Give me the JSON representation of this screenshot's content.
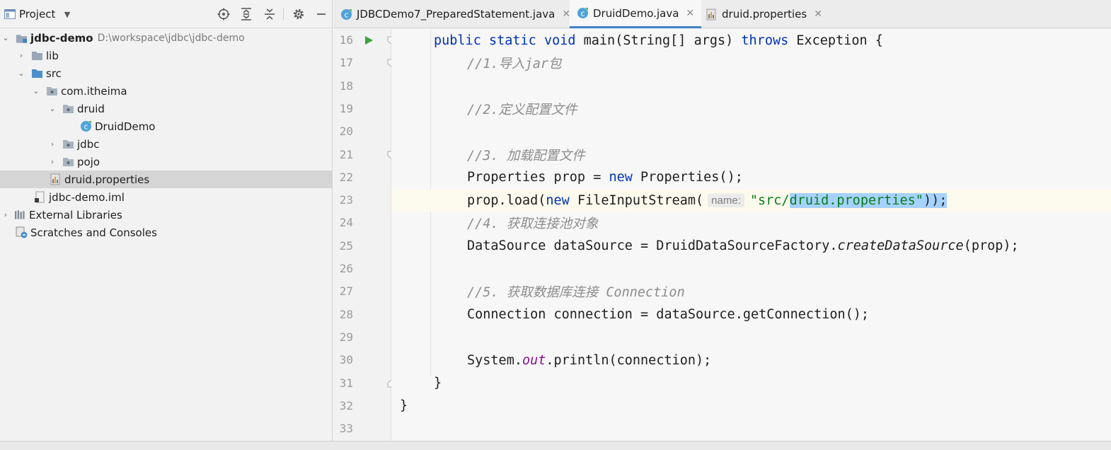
{
  "project_panel": {
    "title": "Project",
    "tree": [
      {
        "label": "jdbc-demo",
        "path": "D:\\workspace\\jdbc\\jdbc-demo",
        "icon": "module-folder-icon",
        "expanded": true
      },
      {
        "label": "lib",
        "icon": "folder-icon",
        "expanded": false
      },
      {
        "label": "src",
        "icon": "source-folder-icon",
        "expanded": true
      },
      {
        "label": "com.itheima",
        "icon": "package-icon",
        "expanded": true
      },
      {
        "label": "druid",
        "icon": "package-icon",
        "expanded": true
      },
      {
        "label": "DruidDemo",
        "icon": "java-class-icon"
      },
      {
        "label": "jdbc",
        "icon": "package-icon",
        "expanded": false
      },
      {
        "label": "pojo",
        "icon": "package-icon",
        "expanded": false
      },
      {
        "label": "druid.properties",
        "icon": "properties-file-icon",
        "selected": true
      },
      {
        "label": "jdbc-demo.iml",
        "icon": "iml-file-icon"
      },
      {
        "label": "External Libraries",
        "icon": "libraries-icon",
        "expanded": false
      },
      {
        "label": "Scratches and Consoles",
        "icon": "scratches-icon"
      }
    ]
  },
  "tabs": [
    {
      "label": "JDBCDemo7_PreparedStatement.java",
      "icon": "java-class-icon",
      "active": false
    },
    {
      "label": "DruidDemo.java",
      "icon": "java-class-icon",
      "active": true
    },
    {
      "label": "druid.properties",
      "icon": "properties-file-icon",
      "active": false
    }
  ],
  "editor": {
    "current_line": 23,
    "lines": [
      {
        "no": "16",
        "tokens": [
          [
            "kw",
            "public "
          ],
          [
            "kw",
            "static "
          ],
          [
            "kw",
            "void "
          ],
          [
            "",
            "main(String[] args) "
          ],
          [
            "kw",
            "throws "
          ],
          [
            "",
            "Exception {"
          ]
        ]
      },
      {
        "no": "17",
        "tokens": [
          [
            "cm",
            "//1.导入jar包"
          ]
        ]
      },
      {
        "no": "18",
        "tokens": []
      },
      {
        "no": "19",
        "tokens": [
          [
            "cm",
            "//2.定义配置文件"
          ]
        ]
      },
      {
        "no": "20",
        "tokens": []
      },
      {
        "no": "21",
        "tokens": [
          [
            "cm",
            "//3. 加载配置文件"
          ]
        ]
      },
      {
        "no": "22",
        "tokens": [
          [
            "",
            "Properties prop = "
          ],
          [
            "kw",
            "new "
          ],
          [
            "",
            "Properties();"
          ]
        ]
      },
      {
        "no": "23",
        "tokens": [
          [
            "",
            "prop.load("
          ],
          [
            "kw",
            "new "
          ],
          [
            "",
            "FileInputStream("
          ],
          [
            "hint",
            "name:"
          ],
          [
            "str",
            "\"src/"
          ],
          [
            "str sel",
            "druid.properties\""
          ],
          [
            "sel",
            "));"
          ]
        ]
      },
      {
        "no": "24",
        "tokens": [
          [
            "cm",
            "//4. 获取连接池对象"
          ]
        ]
      },
      {
        "no": "25",
        "tokens": [
          [
            "",
            "DataSource dataSource = DruidDataSourceFactory."
          ],
          [
            "ital-call",
            "createDataSource"
          ],
          [
            "",
            "(prop);"
          ]
        ]
      },
      {
        "no": "26",
        "tokens": []
      },
      {
        "no": "27",
        "tokens": [
          [
            "cm",
            "//5. 获取数据库连接 Connection"
          ]
        ]
      },
      {
        "no": "28",
        "tokens": [
          [
            "",
            "Connection connection = dataSource.getConnection();"
          ]
        ]
      },
      {
        "no": "29",
        "tokens": []
      },
      {
        "no": "30",
        "tokens": [
          [
            "",
            "System."
          ],
          [
            "field",
            "out"
          ],
          [
            "",
            ".println(connection);"
          ]
        ]
      },
      {
        "no": "31",
        "tokens": [
          [
            "",
            "}"
          ]
        ]
      },
      {
        "no": "32",
        "tokens": [
          [
            "",
            "}"
          ]
        ]
      },
      {
        "no": "33",
        "tokens": []
      }
    ]
  }
}
